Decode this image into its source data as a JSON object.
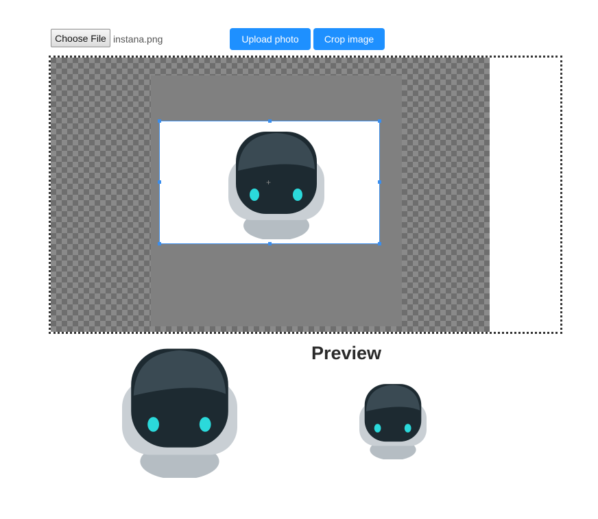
{
  "upload": {
    "choose_file_label": "Choose File",
    "file_name": "instana.png",
    "upload_label": "Upload photo",
    "crop_label": "Crop image"
  },
  "cropper": {
    "center_mark": "+",
    "image_icon": "robot-avatar"
  },
  "preview": {
    "title": "Preview"
  },
  "colors": {
    "accent": "#1e90ff",
    "crop_border": "#3b8eed",
    "robot_face": "#1d2a31",
    "robot_eyes": "#2bd9db",
    "robot_body": "#b5bdc3"
  }
}
